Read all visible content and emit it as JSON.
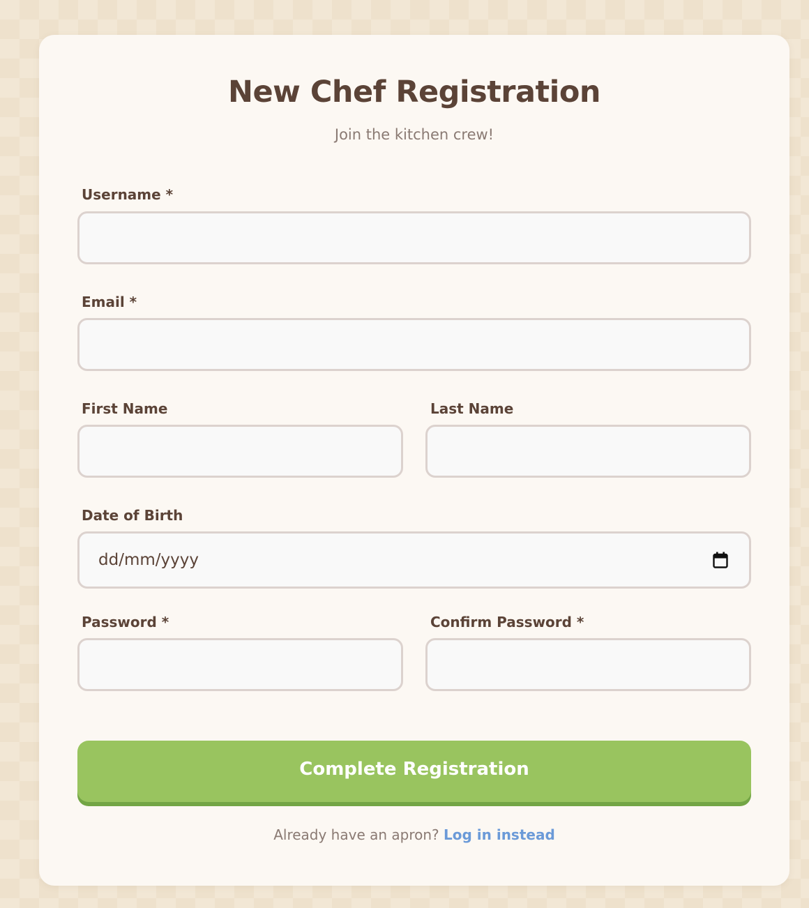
{
  "form": {
    "title": "New Chef Registration",
    "subtitle": "Join the kitchen crew!",
    "fields": {
      "username": {
        "label": "Username *",
        "value": ""
      },
      "email": {
        "label": "Email *",
        "value": ""
      },
      "first_name": {
        "label": "First Name",
        "value": ""
      },
      "last_name": {
        "label": "Last Name",
        "value": ""
      },
      "dob": {
        "label": "Date of Birth",
        "placeholder": "dd/mm/yyyy"
      },
      "password": {
        "label": "Password *",
        "value": ""
      },
      "confirm_password": {
        "label": "Confirm Password *",
        "value": ""
      }
    },
    "submit_label": "Complete Registration",
    "footer_text": "Already have an apron?",
    "login_link": "Log in instead"
  },
  "colors": {
    "background": "#f2e7d5",
    "card": "#fcf8f3",
    "heading": "#5b4337",
    "submit": "#99c45f",
    "link": "#6b9ad8"
  },
  "icons": {
    "date_picker": "calendar-icon"
  }
}
